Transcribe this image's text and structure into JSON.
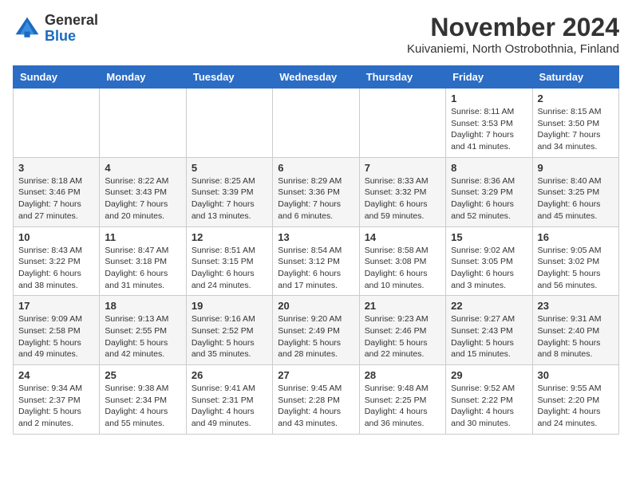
{
  "logo": {
    "general": "General",
    "blue": "Blue"
  },
  "title": "November 2024",
  "subtitle": "Kuivaniemi, North Ostrobothnia, Finland",
  "headers": [
    "Sunday",
    "Monday",
    "Tuesday",
    "Wednesday",
    "Thursday",
    "Friday",
    "Saturday"
  ],
  "weeks": [
    [
      {
        "day": "",
        "info": ""
      },
      {
        "day": "",
        "info": ""
      },
      {
        "day": "",
        "info": ""
      },
      {
        "day": "",
        "info": ""
      },
      {
        "day": "",
        "info": ""
      },
      {
        "day": "1",
        "info": "Sunrise: 8:11 AM\nSunset: 3:53 PM\nDaylight: 7 hours\nand 41 minutes."
      },
      {
        "day": "2",
        "info": "Sunrise: 8:15 AM\nSunset: 3:50 PM\nDaylight: 7 hours\nand 34 minutes."
      }
    ],
    [
      {
        "day": "3",
        "info": "Sunrise: 8:18 AM\nSunset: 3:46 PM\nDaylight: 7 hours\nand 27 minutes."
      },
      {
        "day": "4",
        "info": "Sunrise: 8:22 AM\nSunset: 3:43 PM\nDaylight: 7 hours\nand 20 minutes."
      },
      {
        "day": "5",
        "info": "Sunrise: 8:25 AM\nSunset: 3:39 PM\nDaylight: 7 hours\nand 13 minutes."
      },
      {
        "day": "6",
        "info": "Sunrise: 8:29 AM\nSunset: 3:36 PM\nDaylight: 7 hours\nand 6 minutes."
      },
      {
        "day": "7",
        "info": "Sunrise: 8:33 AM\nSunset: 3:32 PM\nDaylight: 6 hours\nand 59 minutes."
      },
      {
        "day": "8",
        "info": "Sunrise: 8:36 AM\nSunset: 3:29 PM\nDaylight: 6 hours\nand 52 minutes."
      },
      {
        "day": "9",
        "info": "Sunrise: 8:40 AM\nSunset: 3:25 PM\nDaylight: 6 hours\nand 45 minutes."
      }
    ],
    [
      {
        "day": "10",
        "info": "Sunrise: 8:43 AM\nSunset: 3:22 PM\nDaylight: 6 hours\nand 38 minutes."
      },
      {
        "day": "11",
        "info": "Sunrise: 8:47 AM\nSunset: 3:18 PM\nDaylight: 6 hours\nand 31 minutes."
      },
      {
        "day": "12",
        "info": "Sunrise: 8:51 AM\nSunset: 3:15 PM\nDaylight: 6 hours\nand 24 minutes."
      },
      {
        "day": "13",
        "info": "Sunrise: 8:54 AM\nSunset: 3:12 PM\nDaylight: 6 hours\nand 17 minutes."
      },
      {
        "day": "14",
        "info": "Sunrise: 8:58 AM\nSunset: 3:08 PM\nDaylight: 6 hours\nand 10 minutes."
      },
      {
        "day": "15",
        "info": "Sunrise: 9:02 AM\nSunset: 3:05 PM\nDaylight: 6 hours\nand 3 minutes."
      },
      {
        "day": "16",
        "info": "Sunrise: 9:05 AM\nSunset: 3:02 PM\nDaylight: 5 hours\nand 56 minutes."
      }
    ],
    [
      {
        "day": "17",
        "info": "Sunrise: 9:09 AM\nSunset: 2:58 PM\nDaylight: 5 hours\nand 49 minutes."
      },
      {
        "day": "18",
        "info": "Sunrise: 9:13 AM\nSunset: 2:55 PM\nDaylight: 5 hours\nand 42 minutes."
      },
      {
        "day": "19",
        "info": "Sunrise: 9:16 AM\nSunset: 2:52 PM\nDaylight: 5 hours\nand 35 minutes."
      },
      {
        "day": "20",
        "info": "Sunrise: 9:20 AM\nSunset: 2:49 PM\nDaylight: 5 hours\nand 28 minutes."
      },
      {
        "day": "21",
        "info": "Sunrise: 9:23 AM\nSunset: 2:46 PM\nDaylight: 5 hours\nand 22 minutes."
      },
      {
        "day": "22",
        "info": "Sunrise: 9:27 AM\nSunset: 2:43 PM\nDaylight: 5 hours\nand 15 minutes."
      },
      {
        "day": "23",
        "info": "Sunrise: 9:31 AM\nSunset: 2:40 PM\nDaylight: 5 hours\nand 8 minutes."
      }
    ],
    [
      {
        "day": "24",
        "info": "Sunrise: 9:34 AM\nSunset: 2:37 PM\nDaylight: 5 hours\nand 2 minutes."
      },
      {
        "day": "25",
        "info": "Sunrise: 9:38 AM\nSunset: 2:34 PM\nDaylight: 4 hours\nand 55 minutes."
      },
      {
        "day": "26",
        "info": "Sunrise: 9:41 AM\nSunset: 2:31 PM\nDaylight: 4 hours\nand 49 minutes."
      },
      {
        "day": "27",
        "info": "Sunrise: 9:45 AM\nSunset: 2:28 PM\nDaylight: 4 hours\nand 43 minutes."
      },
      {
        "day": "28",
        "info": "Sunrise: 9:48 AM\nSunset: 2:25 PM\nDaylight: 4 hours\nand 36 minutes."
      },
      {
        "day": "29",
        "info": "Sunrise: 9:52 AM\nSunset: 2:22 PM\nDaylight: 4 hours\nand 30 minutes."
      },
      {
        "day": "30",
        "info": "Sunrise: 9:55 AM\nSunset: 2:20 PM\nDaylight: 4 hours\nand 24 minutes."
      }
    ]
  ]
}
